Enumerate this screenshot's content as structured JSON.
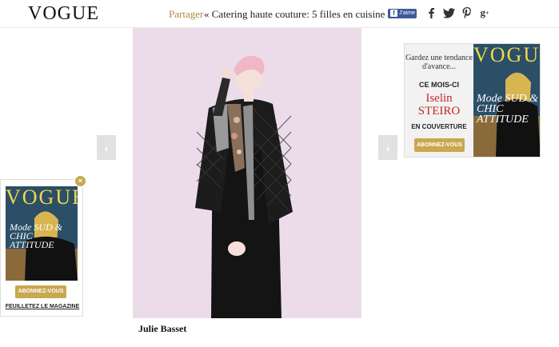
{
  "header": {
    "logo": "VOGUE",
    "share_label": "Partager",
    "article_title": "« Catering haute couture: 5 filles en cuisine »",
    "fb_like": "J'aime",
    "social_icons": [
      "facebook-icon",
      "twitter-icon",
      "pinterest-icon",
      "google-plus-icon"
    ]
  },
  "gallery": {
    "prev_glyph": "‹",
    "next_glyph": "›",
    "caption": "Julie Basset"
  },
  "ad_right": {
    "line1": "Gardez une tendance d'avance...",
    "line2": "CE MOIS-CI",
    "line3a": "Iselin",
    "line3b": "STEIRO",
    "line4": "EN COUVERTURE",
    "button": "ABONNEZ-VOUS",
    "cover_logo": "VOGUE",
    "cover_text": "Mode SUD & CHIC ATTITUDE"
  },
  "ad_left": {
    "cover_logo": "VOGUE",
    "cover_text": "Mode SUD & CHIC ATTITUDE",
    "button": "ABONNEZ-VOUS",
    "link": "FEUILLETEZ LE MAGAZINE",
    "close_glyph": "×"
  },
  "colors": {
    "gold": "#c9a84e",
    "share_gold": "#b08a3a",
    "facebook_blue": "#3b5998",
    "photo_background": "#ecdcea",
    "arrow_gray": "#e1e1e1",
    "cover_blue": "#2b4f67",
    "cover_logo_yellow": "#f2d84a",
    "red": "#c0282a"
  }
}
